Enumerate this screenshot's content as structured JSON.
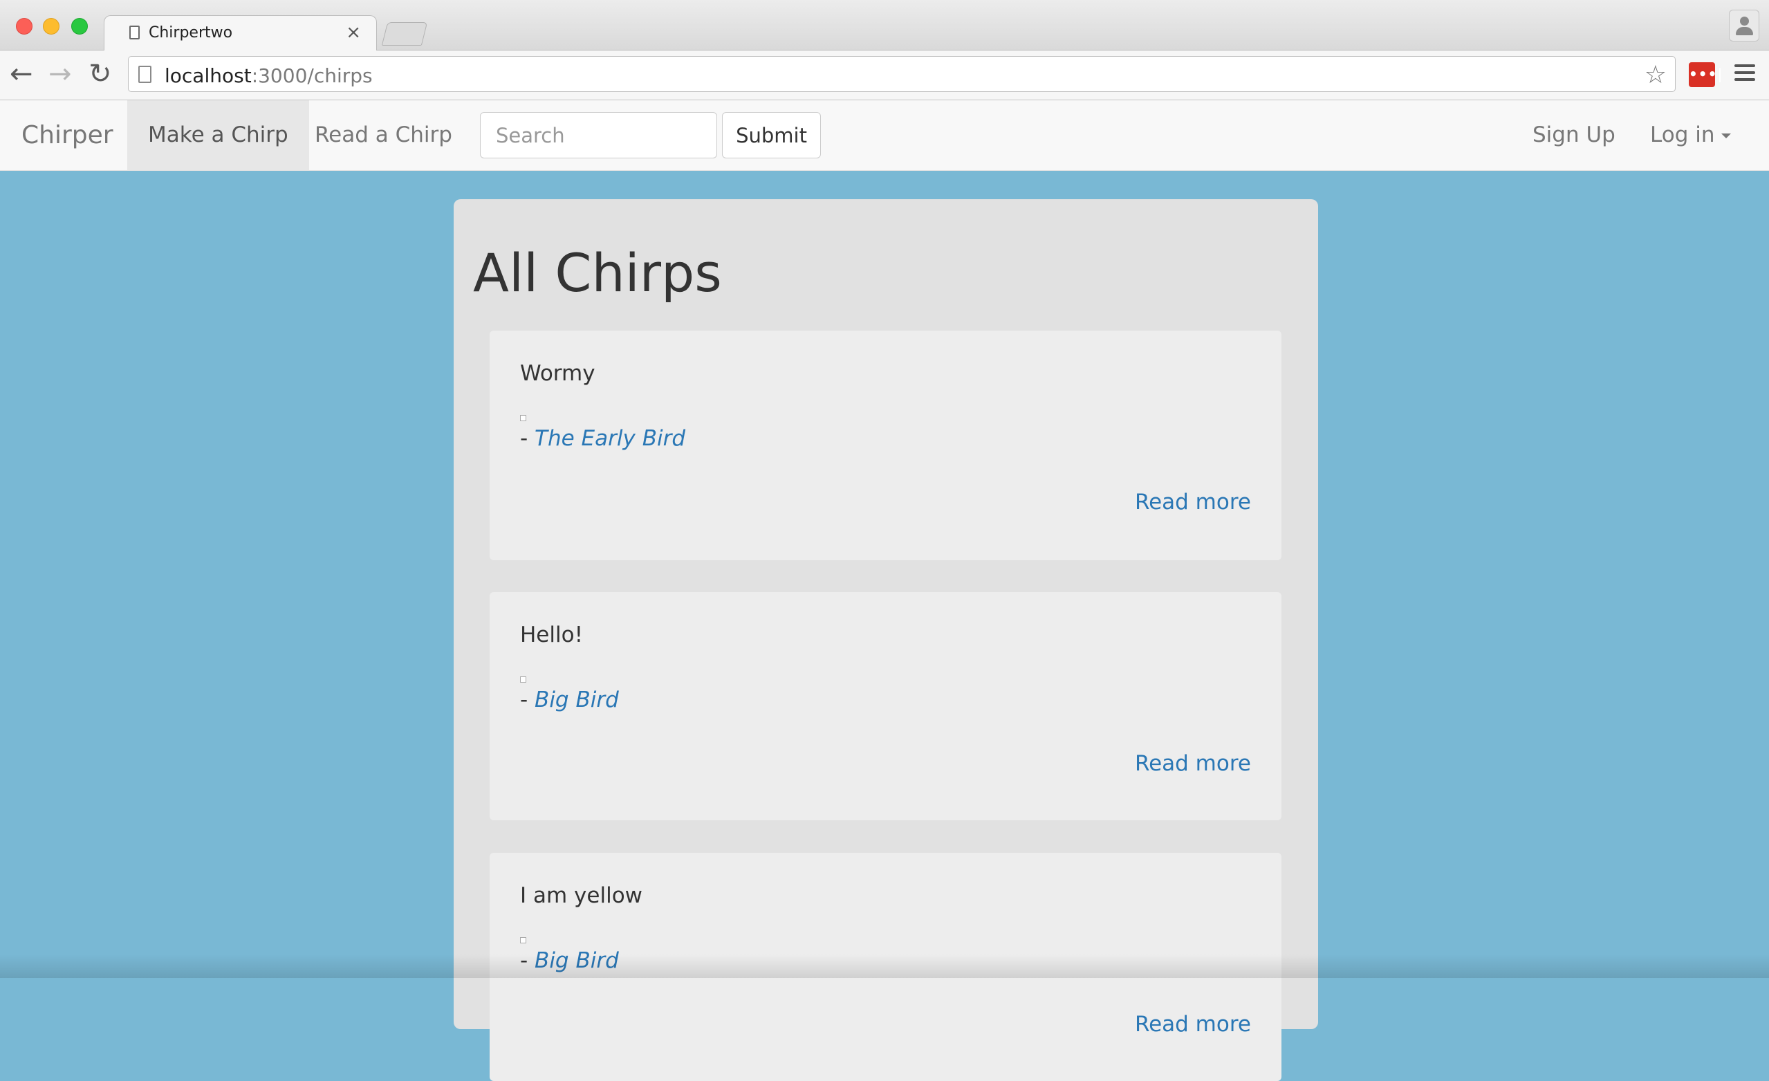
{
  "browser": {
    "tab_title": "Chirpertwo",
    "tab_close": "×",
    "url_host": "localhost",
    "url_path": ":3000/chirps",
    "ext_label": "•••|"
  },
  "icons": {
    "back": "back-arrow-icon",
    "forward": "forward-arrow-icon",
    "reload": "reload-icon",
    "bookmark": "star-icon",
    "menu": "hamburger-menu-icon",
    "profile": "person-icon",
    "extension": "lastpass-icon"
  },
  "navbar": {
    "brand": "Chirper",
    "items": [
      {
        "label": "Make a Chirp",
        "active": true
      },
      {
        "label": "Read a Chirp",
        "active": false
      }
    ],
    "search_placeholder": "Search",
    "submit_label": "Submit",
    "signup_label": "Sign Up",
    "login_label": "Log in"
  },
  "main": {
    "heading": "All Chirps",
    "chirps": [
      {
        "text": "Wormy",
        "author_prefix": "- ",
        "author": "The Early Bird",
        "read_more": "Read more"
      },
      {
        "text": "Hello!",
        "author_prefix": "- ",
        "author": "Big Bird",
        "read_more": "Read more"
      },
      {
        "text": "I am yellow",
        "author_prefix": "- ",
        "author": "Big Bird",
        "read_more": "Read more"
      }
    ]
  },
  "colors": {
    "page_background": "#79b8d4",
    "link": "#2a77b5",
    "container": "#e1e1e1",
    "card": "#ededed"
  }
}
